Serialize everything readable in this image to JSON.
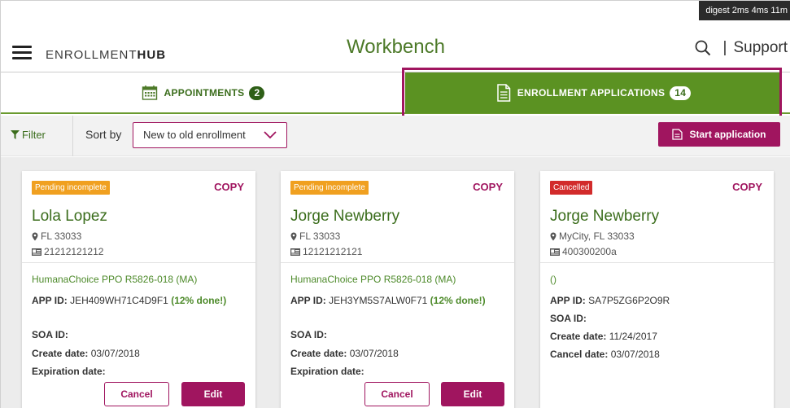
{
  "debug_text": "digest 2ms 4ms 11m",
  "header": {
    "brand_light": "ENROLLMENT",
    "brand_bold": "HUB",
    "title": "Workbench",
    "separator": "|",
    "support_label": "Support"
  },
  "tabs": [
    {
      "label": "APPOINTMENTS",
      "count": "2",
      "active": false
    },
    {
      "label": "ENROLLMENT APPLICATIONS",
      "count": "14",
      "active": true
    }
  ],
  "toolbar": {
    "filter_label": "Filter",
    "sortby_label": "Sort by",
    "sort_value": "New to old enrollment",
    "start_label": "Start application"
  },
  "cards": [
    {
      "status": "Pending incomplete",
      "status_color": "#f0a020",
      "copy_label": "COPY",
      "name": "Lola Lopez",
      "location": "FL 33033",
      "id_number": "21212121212",
      "plan": "HumanaChoice PPO R5826-018 (MA)",
      "app_id_label": "APP ID:",
      "app_id": "JEH409WH71C4D9F1",
      "progress": "(12% done!)",
      "soa_label": "SOA ID:",
      "soa_value": "",
      "create_label": "Create date:",
      "create_date": "03/07/2018",
      "expiration_label": "Expiration date:",
      "cancel_label": "Cancel",
      "edit_label": "Edit"
    },
    {
      "status": "Pending incomplete",
      "status_color": "#f0a020",
      "copy_label": "COPY",
      "name": "Jorge Newberry",
      "location": "FL 33033",
      "id_number": "12121212121",
      "plan": "HumanaChoice PPO R5826-018 (MA)",
      "app_id_label": "APP ID:",
      "app_id": "JEH3YM5S7ALW0F71",
      "progress": "(12% done!)",
      "soa_label": "SOA ID:",
      "soa_value": "",
      "create_label": "Create date:",
      "create_date": "03/07/2018",
      "expiration_label": "Expiration date:",
      "cancel_label": "Cancel",
      "edit_label": "Edit"
    },
    {
      "status": "Cancelled",
      "status_color": "#d22b2b",
      "copy_label": "COPY",
      "name": "Jorge Newberry",
      "location": "MyCity, FL 33033",
      "id_number": "400300200a",
      "plan": "()",
      "app_id_label": "APP ID:",
      "app_id": "SA7P5ZG6P2O9R",
      "soa_label": "SOA ID:",
      "soa_value": "",
      "create_label": "Create date:",
      "create_date": "11/24/2017",
      "cancel_date_label": "Cancel date:",
      "cancel_date": "03/07/2018"
    }
  ],
  "colors": {
    "brand_green": "#5b9222",
    "accent_magenta": "#a0155f",
    "pending_orange": "#f0a020",
    "cancelled_red": "#d22b2b"
  },
  "icons": [
    "hamburger-icon",
    "search-icon",
    "calendar-icon",
    "document-icon",
    "filter-icon",
    "chevron-down-icon",
    "location-pin-icon",
    "id-card-icon"
  ]
}
